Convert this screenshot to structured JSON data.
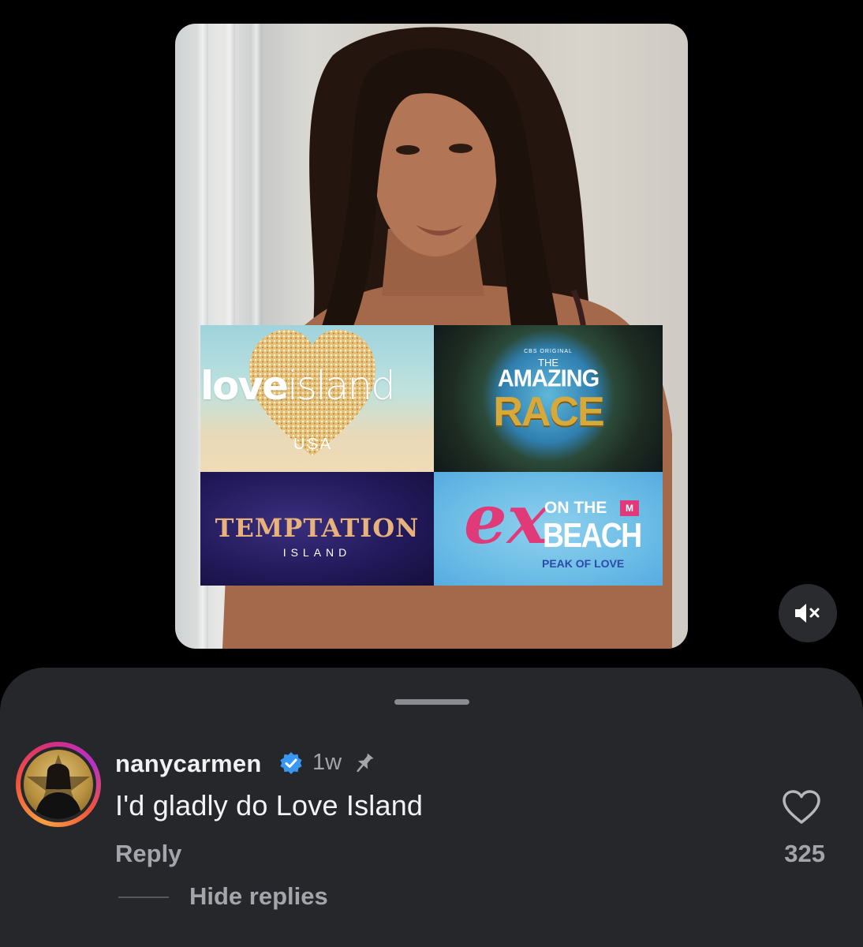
{
  "post": {
    "collage": {
      "love_island": {
        "word_a": "love",
        "word_b": "island",
        "sub": "USA"
      },
      "amazing_race": {
        "network": "CBS ORIGINAL",
        "the": "THE",
        "amazing": "AMAZING",
        "race": "RACE"
      },
      "temptation_island": {
        "main": "TEMPTATION",
        "sub": "ISLAND"
      },
      "ex_on_the_beach": {
        "ex": "ex",
        "on_the": "ON THE",
        "beach": "BEACH",
        "peak": "PEAK OF LOVE",
        "mtv": "M"
      }
    },
    "mute_icon": "speaker-muted-icon"
  },
  "comment": {
    "username": "nanycarmen",
    "verified_icon": "verified-badge-icon",
    "time": "1w",
    "pin_icon": "pin-icon",
    "text": "I'd gladly do Love Island",
    "reply_label": "Reply",
    "like_icon": "heart-outline-icon",
    "like_count": "325",
    "hide_replies_label": "Hide replies"
  },
  "colors": {
    "sheet_bg": "#25272b",
    "muted_text": "#a3a5ab",
    "verified_blue": "#3897f0"
  }
}
